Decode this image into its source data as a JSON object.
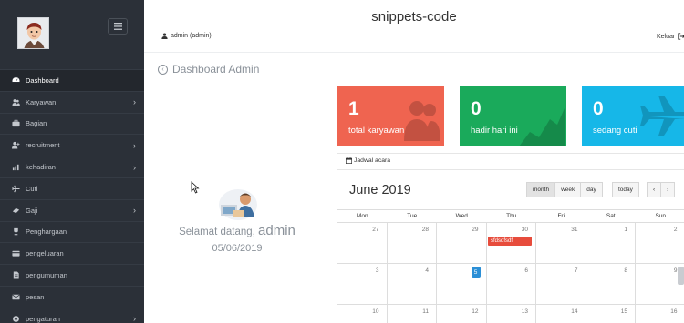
{
  "app": {
    "title": "snippets-code"
  },
  "header": {
    "user": "admin (admin)",
    "logout": "Keluar"
  },
  "page": {
    "title": "Dashboard Admin"
  },
  "sidebar": {
    "items": [
      {
        "label": "Dashboard",
        "icon": "dashboard-icon",
        "has_submenu": false,
        "active": true
      },
      {
        "label": "Karyawan",
        "icon": "users-icon",
        "has_submenu": true
      },
      {
        "label": "Bagian",
        "icon": "briefcase-icon",
        "has_submenu": false
      },
      {
        "label": "recruitment",
        "icon": "user-plus-icon",
        "has_submenu": true
      },
      {
        "label": "kehadiran",
        "icon": "bar-chart-icon",
        "has_submenu": true
      },
      {
        "label": "Cuti",
        "icon": "plane-icon",
        "has_submenu": false
      },
      {
        "label": "Gaji",
        "icon": "money-icon",
        "has_submenu": true
      },
      {
        "label": "Penghargaan",
        "icon": "trophy-icon",
        "has_submenu": false
      },
      {
        "label": "pengeluaran",
        "icon": "credit-card-icon",
        "has_submenu": false
      },
      {
        "label": "pengumuman",
        "icon": "file-icon",
        "has_submenu": false
      },
      {
        "label": "pesan",
        "icon": "envelope-icon",
        "has_submenu": false
      },
      {
        "label": "pengaturan",
        "icon": "settings-icon",
        "has_submenu": true
      }
    ]
  },
  "welcome": {
    "greeting": "Selamat datang,",
    "name": "admin",
    "date": "05/06/2019"
  },
  "cards": [
    {
      "value": "1",
      "label": "total karyawan",
      "color": "#ef6450",
      "icon": "users-icon"
    },
    {
      "value": "0",
      "label": "hadir hari ini",
      "color": "#1aaa5b",
      "icon": "area-chart-icon"
    },
    {
      "value": "0",
      "label": "sedang cuti",
      "color": "#16b7e8",
      "icon": "plane-icon"
    }
  ],
  "calendar": {
    "tab": "Jadwal acara",
    "month": "June 2019",
    "views": [
      "month",
      "week",
      "day"
    ],
    "today_label": "today",
    "prev": "‹",
    "next": "›",
    "days_of_week": [
      "Mon",
      "Tue",
      "Wed",
      "Thu",
      "Fri",
      "Sat",
      "Sun"
    ],
    "weeks": [
      [
        "27",
        "28",
        "29",
        "30",
        "31",
        "1",
        "2"
      ],
      [
        "3",
        "4",
        "5",
        "6",
        "7",
        "8",
        "9"
      ],
      [
        "10",
        "11",
        "12",
        "13",
        "14",
        "15",
        "16"
      ]
    ],
    "today": "5",
    "events": [
      {
        "title": "sfdsdfsdf",
        "date": "30",
        "color": "#e74c3c"
      }
    ]
  }
}
